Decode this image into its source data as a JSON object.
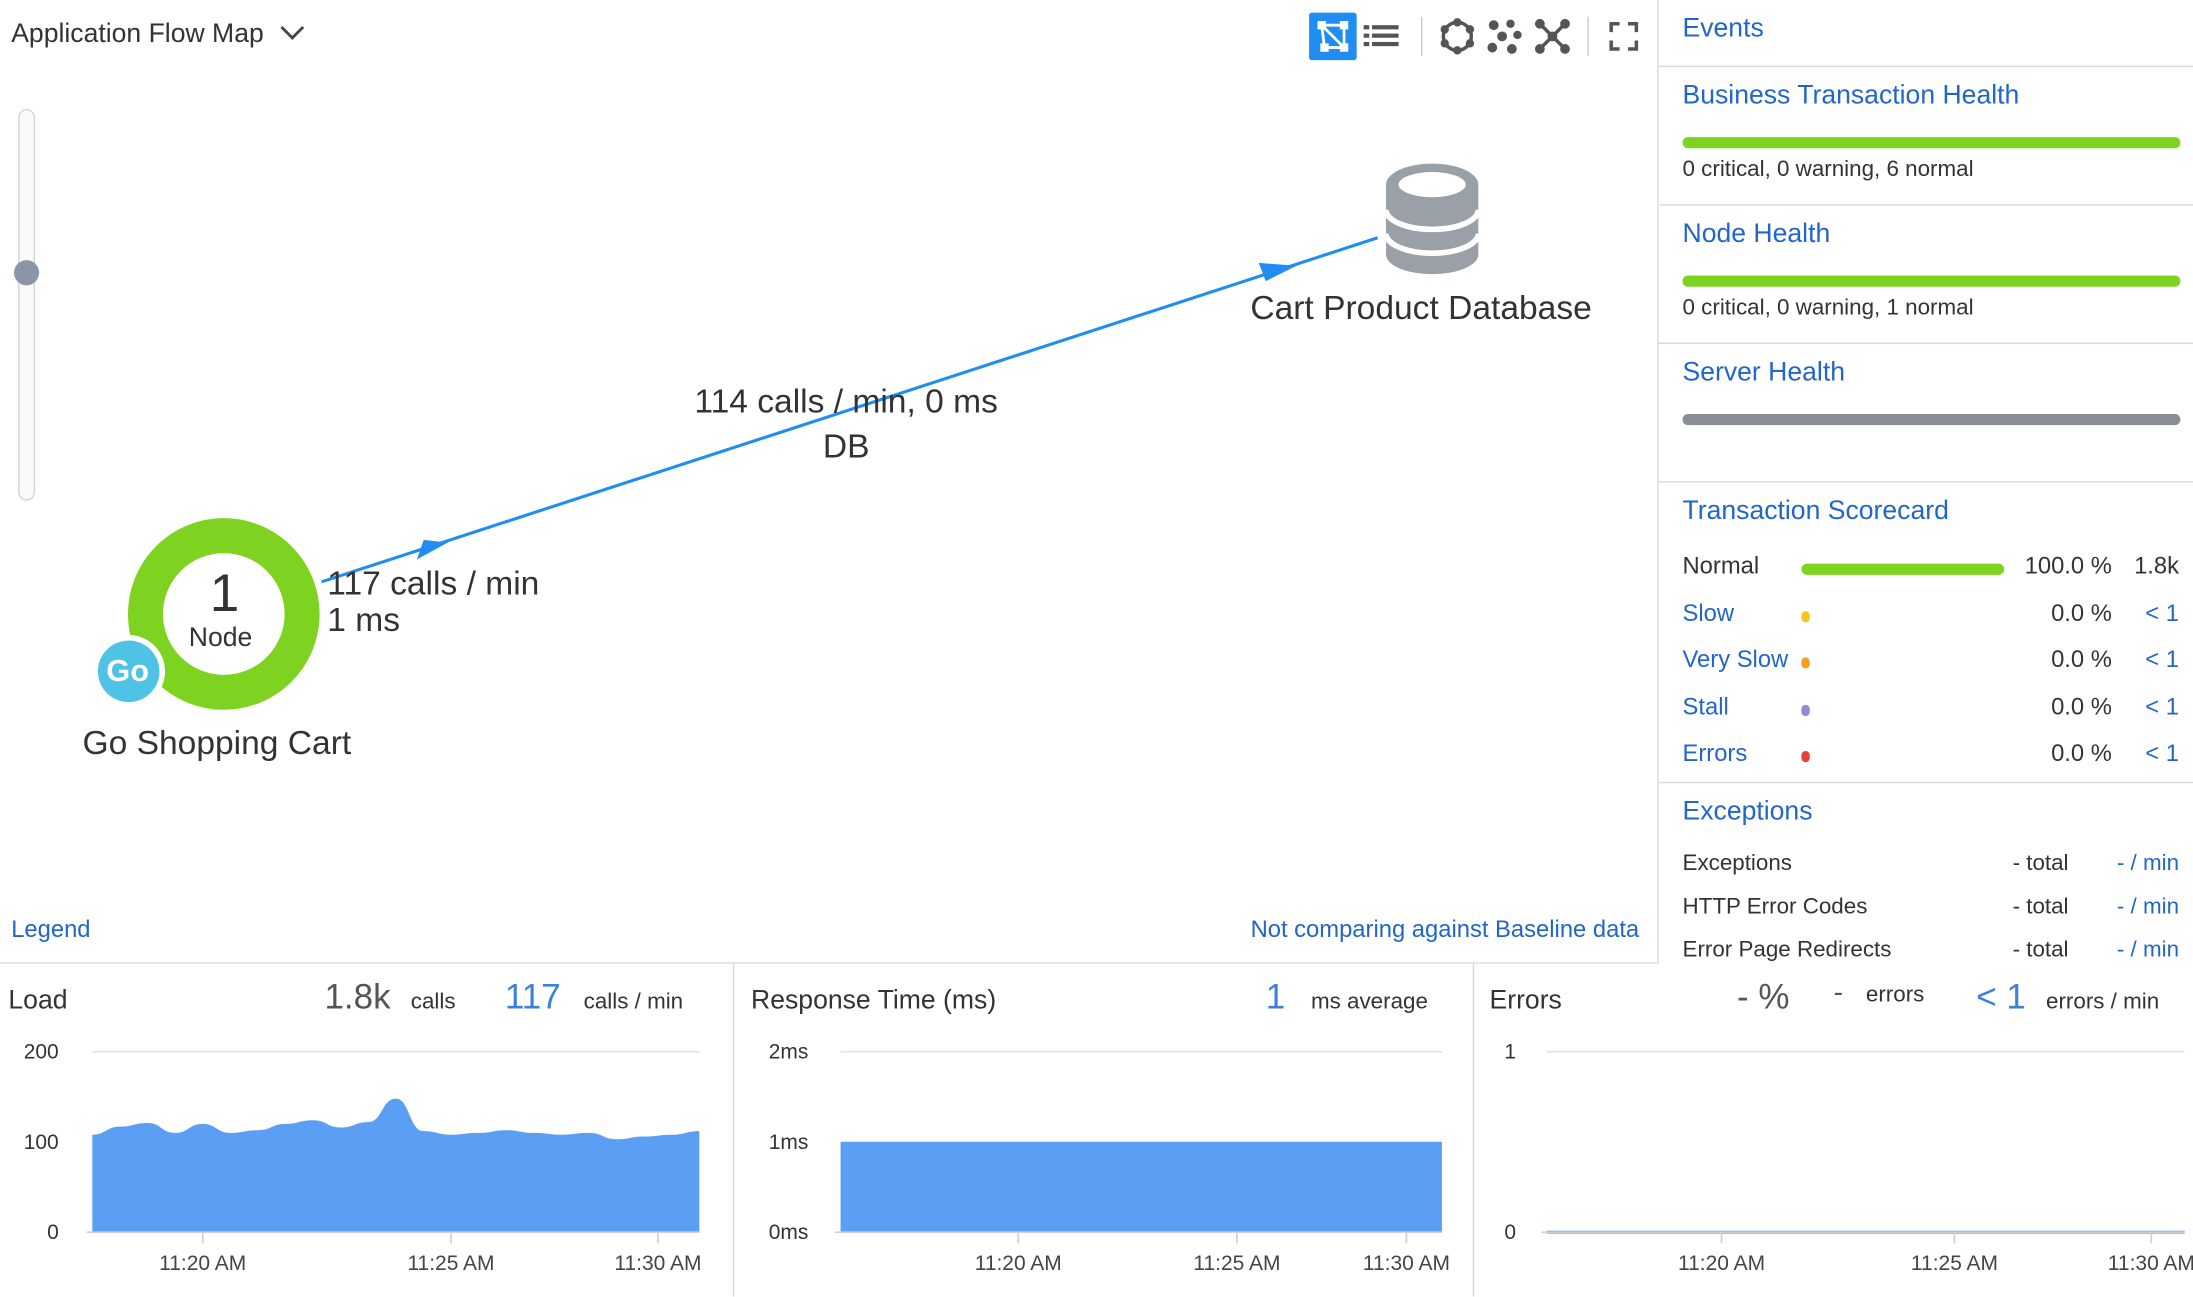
{
  "flowmap": {
    "title": "Application Flow Map",
    "toolbar": [
      "flow-map-view-icon",
      "grid-view-icon",
      "circle-layout-icon",
      "scatter-layout-icon",
      "collapse-icon",
      "fullscreen-icon"
    ],
    "app_node": {
      "count": "1",
      "count_label": "Node",
      "badge": "Go",
      "name": "Go Shopping Cart",
      "health_color": "#7ed321"
    },
    "db_node": {
      "name": "Cart Product Database"
    },
    "outgoing_edge": {
      "line1": "117 calls / min",
      "line2": "1 ms"
    },
    "db_edge": {
      "line1": "114 calls / min, 0 ms",
      "line2": "DB"
    },
    "legend": "Legend",
    "baseline": "Not comparing against Baseline data"
  },
  "right_panel": {
    "events": "Events",
    "bt_health": {
      "title": "Business Transaction Health",
      "summary": "0 critical, 0 warning, 6 normal",
      "color": "#7ed321"
    },
    "node_health": {
      "title": "Node Health",
      "summary": "0 critical, 0 warning, 1 normal",
      "color": "#7ed321"
    },
    "server_health": {
      "title": "Server Health",
      "color": "#8a8f96"
    },
    "scorecard": {
      "title": "Transaction Scorecard",
      "rows": [
        {
          "name": "Normal",
          "percent": "100.0 %",
          "count": "1.8k",
          "color": "#7ed321",
          "fill": 1.0
        },
        {
          "name": "Slow",
          "percent": "0.0 %",
          "count": "< 1",
          "color": "#f5c518"
        },
        {
          "name": "Very Slow",
          "percent": "0.0 %",
          "count": "< 1",
          "color": "#f5a020"
        },
        {
          "name": "Stall",
          "percent": "0.0 %",
          "count": "< 1",
          "color": "#9b85d6"
        },
        {
          "name": "Errors",
          "percent": "0.0 %",
          "count": "< 1",
          "color": "#e8403c"
        }
      ]
    },
    "exceptions": {
      "title": "Exceptions",
      "rows": [
        {
          "name": "Exceptions",
          "total": "- total",
          "rate": "- / min"
        },
        {
          "name": "HTTP Error Codes",
          "total": "- total",
          "rate": "- / min"
        },
        {
          "name": "Error Page Redirects",
          "total": "- total",
          "rate": "- / min"
        }
      ]
    }
  },
  "load": {
    "title": "Load",
    "calls_value": "1.8k",
    "calls_unit": "calls",
    "rate_value": "117",
    "rate_unit": "calls / min"
  },
  "response": {
    "title": "Response Time (ms)",
    "avg_value": "1",
    "avg_unit": "ms average"
  },
  "errors": {
    "title": "Errors",
    "pct_value": "- %",
    "count_value": "-",
    "count_unit": "errors",
    "rate_value": "< 1",
    "rate_unit": "errors / min"
  },
  "chart_data": [
    {
      "type": "area",
      "name": "load",
      "yticks": [
        "0",
        "100",
        "200"
      ],
      "ylim": [
        0,
        200
      ],
      "xlim": [
        0,
        22
      ],
      "xticks": [
        {
          "x": 4,
          "label": "11:20 AM"
        },
        {
          "x": 13,
          "label": "11:25 AM"
        },
        {
          "x": 20.5,
          "label": "11:30 AM"
        }
      ],
      "x": [
        0,
        1,
        2,
        3,
        4,
        5,
        6,
        7,
        8,
        9,
        10,
        11,
        12,
        13,
        14,
        15,
        16,
        17,
        18,
        19,
        20,
        21,
        22
      ],
      "values": [
        108,
        117,
        121,
        110,
        120,
        110,
        113,
        120,
        124,
        116,
        122,
        148,
        112,
        108,
        110,
        113,
        110,
        108,
        110,
        103,
        106,
        108,
        112
      ],
      "color": "#5b9ff5"
    },
    {
      "type": "area",
      "name": "response_time",
      "yticks": [
        "0ms",
        "1ms",
        "2ms"
      ],
      "ylim": [
        0,
        2
      ],
      "xlim": [
        0,
        22
      ],
      "xticks": [
        {
          "x": 6.5,
          "label": "11:20 AM"
        },
        {
          "x": 14.5,
          "label": "11:25 AM"
        },
        {
          "x": 20.7,
          "label": "11:30 AM"
        }
      ],
      "x": [
        0,
        22
      ],
      "values": [
        1,
        1
      ],
      "color": "#5b9ff5"
    },
    {
      "type": "line",
      "name": "errors",
      "yticks": [
        "0",
        "1"
      ],
      "ylim": [
        0,
        1
      ],
      "xlim": [
        0,
        23
      ],
      "xticks": [
        {
          "x": 6.3,
          "label": "11:20 AM"
        },
        {
          "x": 14.7,
          "label": "11:25 AM"
        },
        {
          "x": 21.8,
          "label": "11:30 AM"
        }
      ],
      "x": [
        0,
        23
      ],
      "values": [
        0,
        0
      ],
      "color": "#5b9ff5"
    }
  ]
}
